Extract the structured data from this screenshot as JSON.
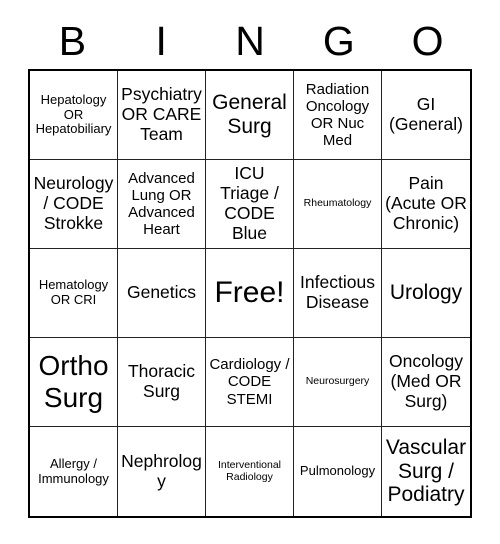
{
  "header": {
    "letters": [
      "B",
      "I",
      "N",
      "G",
      "O"
    ]
  },
  "grid": {
    "rows": 5,
    "columns": 5,
    "cells": [
      {
        "text": "Hepatology OR Hepatobiliary",
        "size": "fs-sm"
      },
      {
        "text": "Psychiatry OR CARE Team",
        "size": "fs-lg"
      },
      {
        "text": "General Surg",
        "size": "fs-xl"
      },
      {
        "text": "Radiation Oncology OR Nuc Med",
        "size": "fs-md"
      },
      {
        "text": "GI (General)",
        "size": "fs-lg"
      },
      {
        "text": "Neurology / CODE Strokke",
        "size": "fs-lg"
      },
      {
        "text": "Advanced Lung OR Advanced Heart",
        "size": "fs-md"
      },
      {
        "text": "ICU Triage / CODE Blue",
        "size": "fs-lg"
      },
      {
        "text": "Rheumatology",
        "size": "fs-xs"
      },
      {
        "text": "Pain (Acute OR Chronic)",
        "size": "fs-lg"
      },
      {
        "text": "Hematology OR CRI",
        "size": "fs-sm"
      },
      {
        "text": "Genetics",
        "size": "fs-lg"
      },
      {
        "text": "Free!",
        "size": "fs-free"
      },
      {
        "text": "Infectious Disease",
        "size": "fs-lg"
      },
      {
        "text": "Urology",
        "size": "fs-xl"
      },
      {
        "text": "Ortho Surg",
        "size": "fs-xxl"
      },
      {
        "text": "Thoracic Surg",
        "size": "fs-lg"
      },
      {
        "text": "Cardiology / CODE STEMI",
        "size": "fs-md"
      },
      {
        "text": "Neurosurgery",
        "size": "fs-xs"
      },
      {
        "text": "Oncology (Med OR Surg)",
        "size": "fs-lg"
      },
      {
        "text": "Allergy / Immunology",
        "size": "fs-sm"
      },
      {
        "text": "Nephrology",
        "size": "fs-lg"
      },
      {
        "text": "Interventional Radiology",
        "size": "fs-xs"
      },
      {
        "text": "Pulmonology",
        "size": "fs-sm"
      },
      {
        "text": "Vascular Surg / Podiatry",
        "size": "fs-xl"
      }
    ]
  }
}
